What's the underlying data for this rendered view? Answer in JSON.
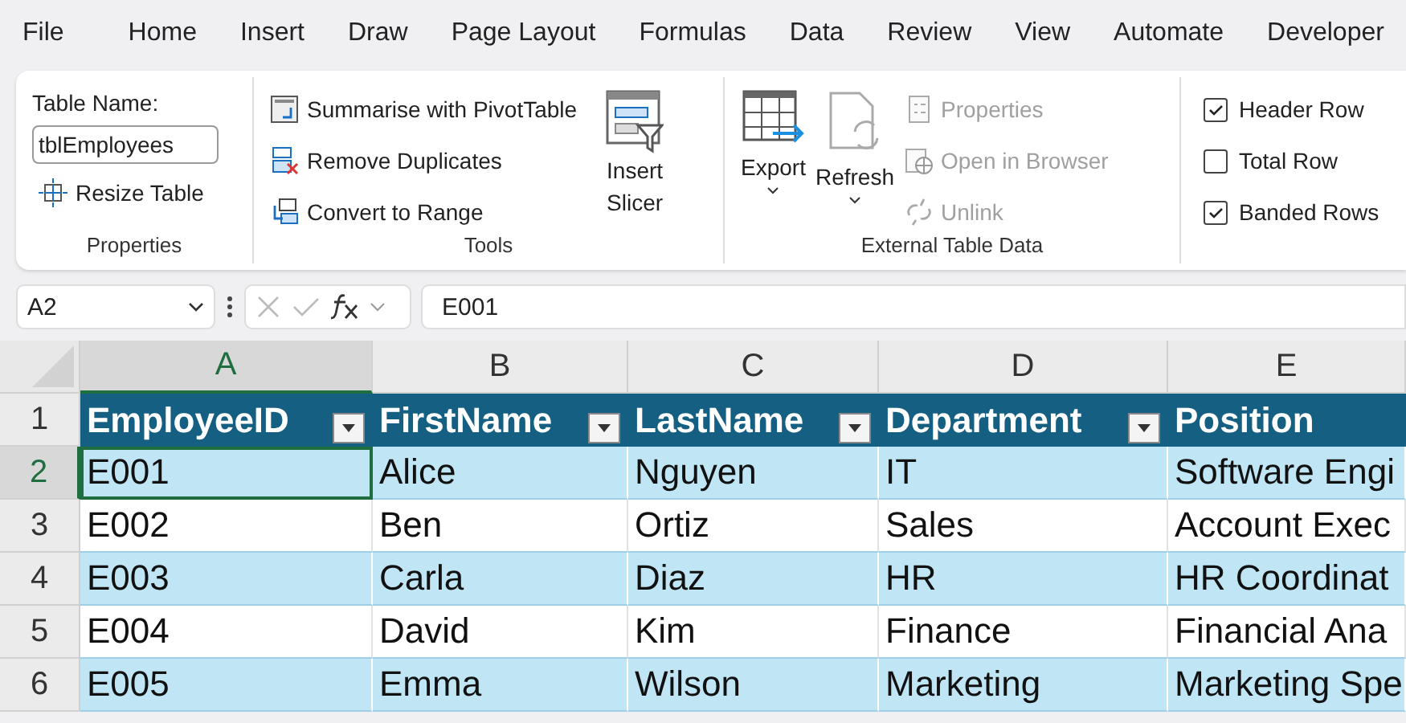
{
  "menu_tabs": [
    {
      "label": "File"
    },
    {
      "label": "Home"
    },
    {
      "label": "Insert"
    },
    {
      "label": "Draw"
    },
    {
      "label": "Page Layout"
    },
    {
      "label": "Formulas"
    },
    {
      "label": "Data"
    },
    {
      "label": "Review"
    },
    {
      "label": "View"
    },
    {
      "label": "Automate"
    },
    {
      "label": "Developer"
    }
  ],
  "ribbon": {
    "properties": {
      "label": "Properties",
      "table_name_label": "Table Name:",
      "table_name_value": "tblEmployees",
      "resize_label": "Resize Table"
    },
    "tools": {
      "label": "Tools",
      "items": [
        {
          "label": "Summarise with PivotTable"
        },
        {
          "label": "Remove Duplicates"
        },
        {
          "label": "Convert to Range"
        }
      ],
      "slicer_label": [
        "Insert",
        "Slicer"
      ]
    },
    "external": {
      "label": "External Table Data",
      "export_label": "Export",
      "refresh_label": "Refresh",
      "items": [
        {
          "label": "Properties",
          "disabled": true
        },
        {
          "label": "Open in Browser",
          "disabled": true
        },
        {
          "label": "Unlink",
          "disabled": true
        }
      ]
    },
    "style_options": [
      {
        "label": "Header Row",
        "checked": true
      },
      {
        "label": "Total Row",
        "checked": false
      },
      {
        "label": "Banded Rows",
        "checked": true
      }
    ]
  },
  "formula_bar": {
    "name_box": "A2",
    "formula": "E001"
  },
  "columns": [
    {
      "letter": "A",
      "header": "EmployeeID",
      "selected": true
    },
    {
      "letter": "B",
      "header": "FirstName",
      "selected": false
    },
    {
      "letter": "C",
      "header": "LastName",
      "selected": false
    },
    {
      "letter": "D",
      "header": "Department",
      "selected": false
    },
    {
      "letter": "E",
      "header": "Position",
      "selected": false
    }
  ],
  "header_row_number": "1",
  "rows": [
    {
      "number": "2",
      "selected": true,
      "cells": [
        "E001",
        "Alice",
        "Nguyen",
        "IT",
        "Software Engi"
      ]
    },
    {
      "number": "3",
      "selected": false,
      "cells": [
        "E002",
        "Ben",
        "Ortiz",
        "Sales",
        "Account Exec"
      ]
    },
    {
      "number": "4",
      "selected": false,
      "cells": [
        "E003",
        "Carla",
        "Diaz",
        "HR",
        "HR Coordinat"
      ]
    },
    {
      "number": "5",
      "selected": false,
      "cells": [
        "E004",
        "David",
        "Kim",
        "Finance",
        "Financial Ana"
      ]
    },
    {
      "number": "6",
      "selected": false,
      "cells": [
        "E005",
        "Emma",
        "Wilson",
        "Marketing",
        "Marketing Spe"
      ]
    }
  ]
}
